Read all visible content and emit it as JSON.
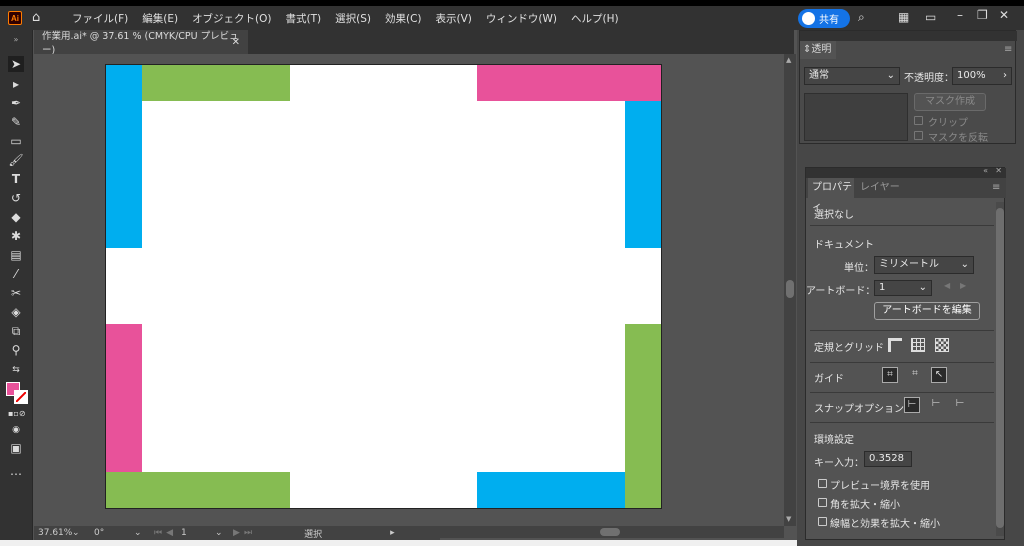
{
  "app": {
    "logo": "Ai"
  },
  "menu": [
    "ファイル(F)",
    "編集(E)",
    "オブジェクト(O)",
    "書式(T)",
    "選択(S)",
    "効果(C)",
    "表示(V)",
    "ウィンドウ(W)",
    "ヘルプ(H)"
  ],
  "share_label": "共有",
  "document": {
    "tab_title": "作業用.ai* @ 37.61 % (CMYK/CPU プレビュー)"
  },
  "status": {
    "zoom": "37.61%",
    "rotation": "0°",
    "artboard": "1",
    "tool": "選択"
  },
  "colors": {
    "blue": "#00AEEF",
    "green": "#86BC52",
    "pink": "#E8529A",
    "fill": "#E8529A"
  },
  "transparency": {
    "tab": "透明",
    "blend_mode": "通常",
    "opacity_label": "不透明度：",
    "opacity_value": "100%",
    "make_mask": "マスク作成",
    "clip": "クリップ",
    "invert_mask": "マスクを反転"
  },
  "properties": {
    "tab_properties": "プロパティ",
    "tab_layers": "レイヤー",
    "no_selection": "選択なし",
    "document_header": "ドキュメント",
    "units_label": "単位：",
    "units_value": "ミリメートル",
    "artboard_label": "アートボード：",
    "artboard_value": "1",
    "edit_artboards": "アートボードを編集",
    "rulers_grids": "定規とグリッド",
    "guides": "ガイド",
    "snap_options": "スナップオプション",
    "preferences": "環境設定",
    "key_increment_label": "キー入力：",
    "key_increment_value": "0.3528 m",
    "preview_bounds": "プレビュー境界を使用",
    "scale_corners": "角を拡大・縮小",
    "scale_strokes": "線幅と効果を拡大・縮小"
  }
}
